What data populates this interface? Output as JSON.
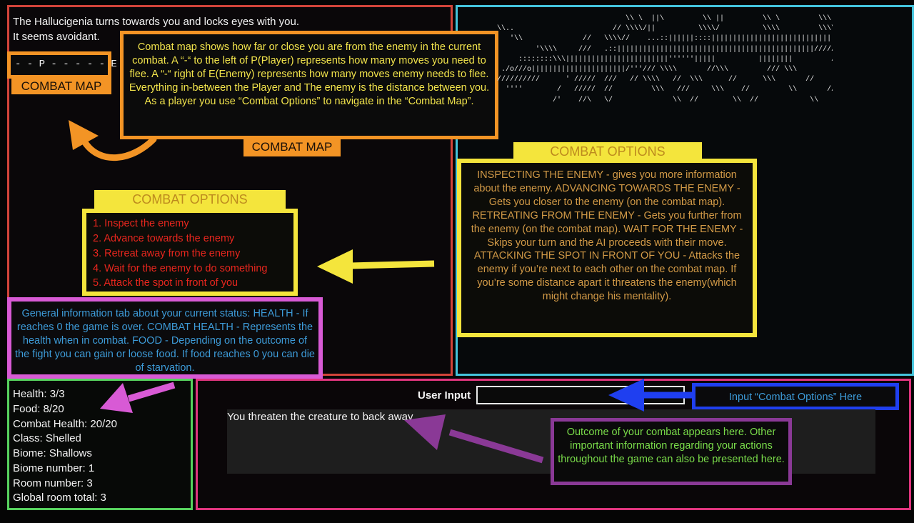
{
  "story": {
    "lines": [
      "The Hallucigenia turns towards you and locks eyes with you.",
      "It seems avoidant."
    ]
  },
  "combat_map": {
    "display": "- - P - - - - - E -",
    "label_left": "COMBAT MAP",
    "label_right": "COMBAT MAP",
    "explanation": "Combat map shows how far or close you are from the enemy in the current combat. A “-“ to the left of P(Player) represents how many moves you need to flee. A “-“ right of E(Enemy) represents how many moves enemy needs to flee. Everything in-between the Player and The enemy is the distance between you. As a player you use “Combat Options” to navigate in the “Combat Map”."
  },
  "combat_options": {
    "label_left": "COMBAT OPTIONS",
    "label_right": "COMBAT OPTIONS",
    "items": [
      "1. Inspect the enemy",
      "2. Advance towards the enemy",
      "3. Retreat away from the enemy",
      "4. Wait for the enemy to do something",
      "5. Attack the spot in front of you"
    ],
    "explanation": "INSPECTING THE ENEMY - gives you more information about the enemy. ADVANCING TOWARDS THE ENEMY - Gets you closer to the enemy (on the combat map). RETREATING FROM THE ENEMY - Gets you further from the enemy (on the combat map). WAIT FOR THE ENEMY - Skips your turn and the AI proceeds with their move. ATTACKING THE SPOT IN FRONT OF YOU - Attacks the enemy if you’re next to each other on the combat map. If you’re some distance apart it threatens the enemy(which might change his mentality)."
  },
  "status_info": {
    "explanation": "General information tab about your current status: HEALTH - If reaches 0 the game is over. COMBAT HEALTH - Represents the health when in combat. FOOD - Depending on the outcome of the fight you can gain or loose food. If food reaches 0 you can die of starvation."
  },
  "stats": [
    "Health: 3/3",
    "Food: 8/20",
    "Combat Health: 20/20",
    "Class: Shelled",
    "Biome: Shallows",
    "Biome number: 1",
    "Room number: 3",
    "Global room total: 3"
  ],
  "input": {
    "label": "User Input",
    "value": "",
    "hint": "Input “Combat Options” Here"
  },
  "output": {
    "text": "You threaten the creature to back away"
  },
  "outcome_info": {
    "explanation": "Outcome of your combat appears here. Other important information regarding your actions throughout the game can also be presented here."
  },
  "colors": {
    "story_border": "#d2443a",
    "art_border": "#44c4dc",
    "stats_border": "#57d25e",
    "io_border": "#e0357e",
    "annotation_orange": "#f39425",
    "annotation_yellow": "#f4e53c",
    "annotation_magenta": "#d85ad5",
    "annotation_blue": "#1f3ff0",
    "annotation_purple": "#8a3996",
    "options_red": "#e8261e"
  }
}
